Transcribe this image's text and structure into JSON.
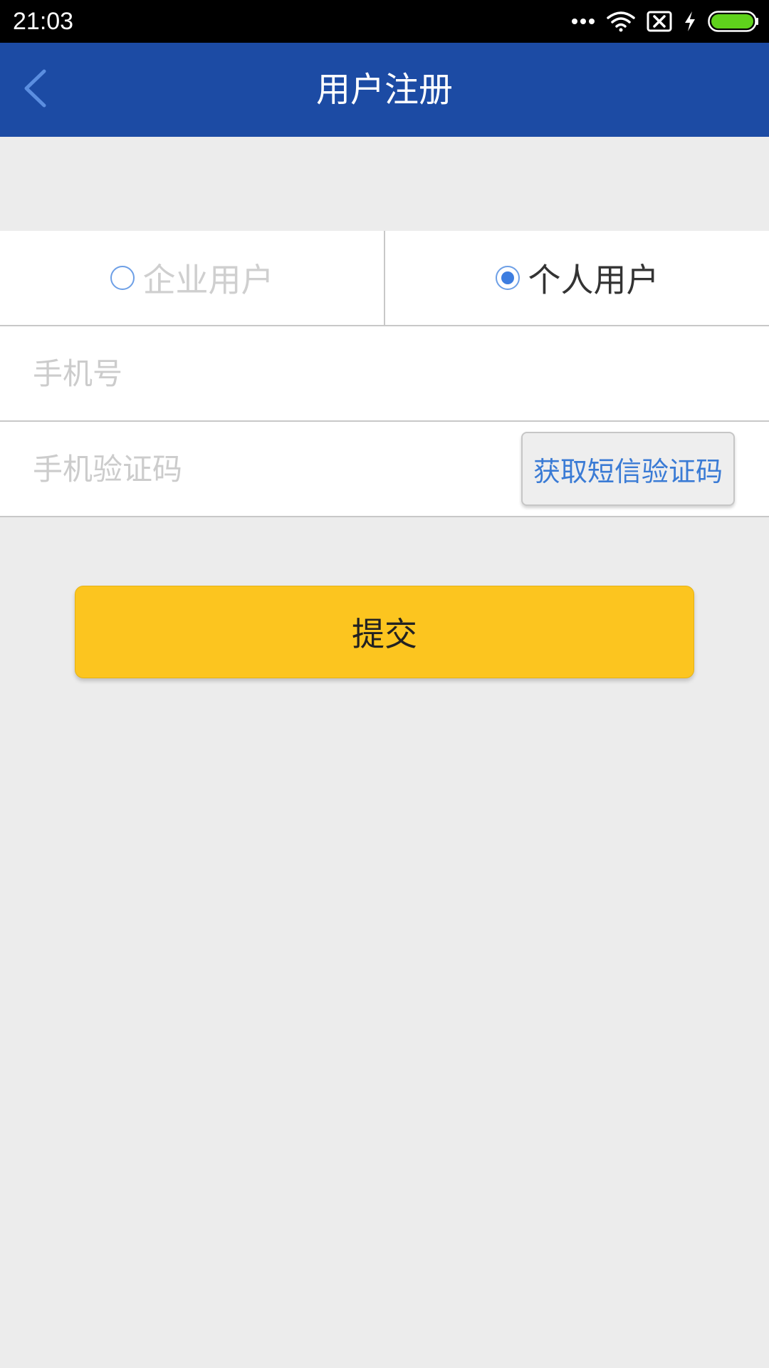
{
  "status_bar": {
    "time": "21:03",
    "icons": [
      "more-dots-icon",
      "wifi-icon",
      "sim-error-icon",
      "charging-icon",
      "battery-icon"
    ],
    "battery_color": "#5fd21c"
  },
  "header": {
    "back_icon": "chevron-left-icon",
    "title": "用户注册",
    "background": "#1c4ba4"
  },
  "user_type": {
    "options": [
      {
        "label": "企业用户",
        "selected": false
      },
      {
        "label": "个人用户",
        "selected": true
      }
    ]
  },
  "form": {
    "phone_placeholder": "手机号",
    "code_placeholder": "手机验证码",
    "sms_button_label": "获取短信验证码"
  },
  "submit": {
    "label": "提交",
    "color": "#fcc51f"
  }
}
